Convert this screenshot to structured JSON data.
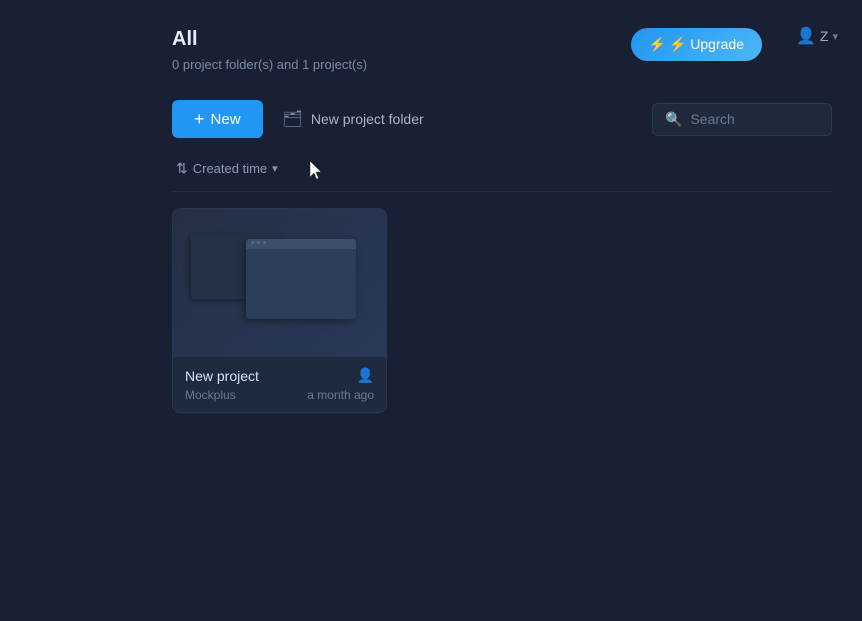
{
  "header": {
    "page_title": "All",
    "subtitle": "0 project folder(s) and 1 project(s)",
    "upgrade_label": "⚡ Upgrade",
    "user_label": "Z",
    "user_chevron": "▾"
  },
  "toolbar": {
    "new_button_label": "New",
    "new_folder_label": "New project folder",
    "search_placeholder": "Search"
  },
  "sort": {
    "label": "Created time",
    "chevron": "▾"
  },
  "projects": [
    {
      "name": "New project",
      "owner": "Mockplus",
      "time": "a month ago"
    }
  ]
}
